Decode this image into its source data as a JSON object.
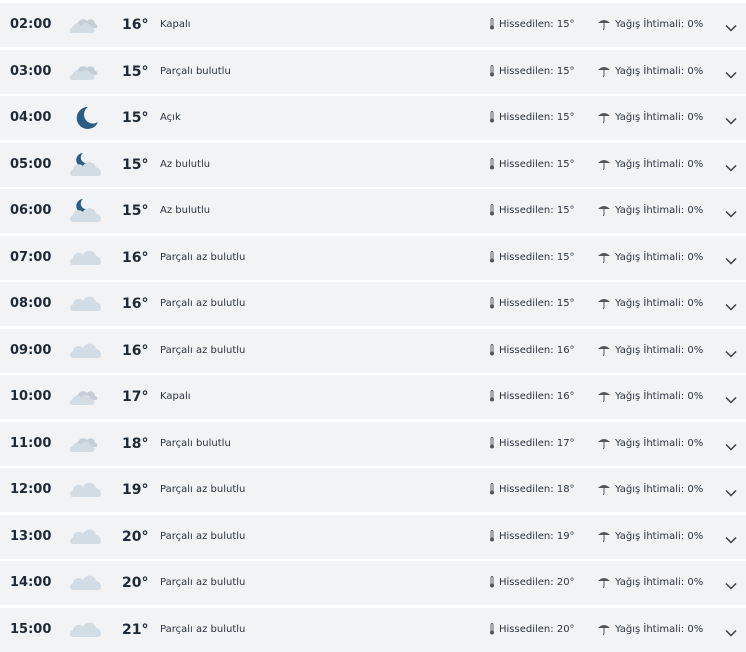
{
  "labels": {
    "feels_like": "Hissedilen:",
    "rain_chance": "Yağış İhtimali:"
  },
  "colors": {
    "row_bg": "#f1f3f5",
    "cloud": "#d2dce5",
    "moon": "#2c5d85",
    "text": "#1e2a38"
  },
  "hours": [
    {
      "time": "02:00",
      "icon": "overcast-icon",
      "temp": "16°",
      "desc": "Kapalı",
      "feels": "15°",
      "rain": "0%"
    },
    {
      "time": "03:00",
      "icon": "overcast-icon",
      "temp": "15°",
      "desc": "Parçalı bulutlu",
      "feels": "15°",
      "rain": "0%"
    },
    {
      "time": "04:00",
      "icon": "moon-icon",
      "temp": "15°",
      "desc": "Açık",
      "feels": "15°",
      "rain": "0%"
    },
    {
      "time": "05:00",
      "icon": "moon-cloud-icon",
      "temp": "15°",
      "desc": "Az bulutlu",
      "feels": "15°",
      "rain": "0%"
    },
    {
      "time": "06:00",
      "icon": "moon-cloud-icon",
      "temp": "15°",
      "desc": "Az bulutlu",
      "feels": "15°",
      "rain": "0%"
    },
    {
      "time": "07:00",
      "icon": "cloud-icon",
      "temp": "16°",
      "desc": "Parçalı az bulutlu",
      "feels": "15°",
      "rain": "0%"
    },
    {
      "time": "08:00",
      "icon": "cloud-icon",
      "temp": "16°",
      "desc": "Parçalı az bulutlu",
      "feels": "15°",
      "rain": "0%"
    },
    {
      "time": "09:00",
      "icon": "cloud-icon",
      "temp": "16°",
      "desc": "Parçalı az bulutlu",
      "feels": "16°",
      "rain": "0%"
    },
    {
      "time": "10:00",
      "icon": "overcast-icon",
      "temp": "17°",
      "desc": "Kapalı",
      "feels": "16°",
      "rain": "0%"
    },
    {
      "time": "11:00",
      "icon": "overcast-icon",
      "temp": "18°",
      "desc": "Parçalı bulutlu",
      "feels": "17°",
      "rain": "0%"
    },
    {
      "time": "12:00",
      "icon": "cloud-icon",
      "temp": "19°",
      "desc": "Parçalı az bulutlu",
      "feels": "18°",
      "rain": "0%"
    },
    {
      "time": "13:00",
      "icon": "cloud-icon",
      "temp": "20°",
      "desc": "Parçalı az bulutlu",
      "feels": "19°",
      "rain": "0%"
    },
    {
      "time": "14:00",
      "icon": "cloud-icon",
      "temp": "20°",
      "desc": "Parçalı az bulutlu",
      "feels": "20°",
      "rain": "0%"
    },
    {
      "time": "15:00",
      "icon": "cloud-icon",
      "temp": "21°",
      "desc": "Parçalı az bulutlu",
      "feels": "20°",
      "rain": "0%"
    }
  ]
}
